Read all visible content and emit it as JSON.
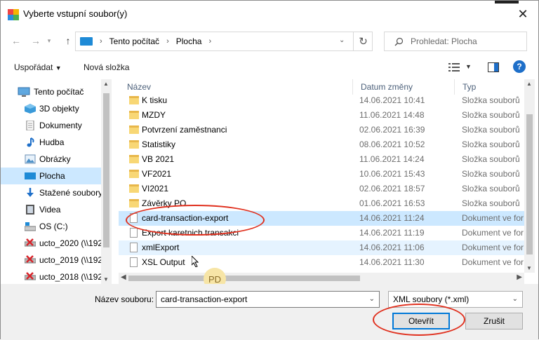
{
  "window": {
    "title": "Vyberte vstupní soubor(y)",
    "close_glyph": "✕"
  },
  "nav": {
    "back_glyph": "←",
    "forward_glyph": "→",
    "up_glyph": "↑",
    "breadcrumbs": [
      "Tento počítač",
      "Plocha"
    ],
    "refresh_glyph": "↻",
    "search_placeholder": "Prohledat: Plocha"
  },
  "toolbar": {
    "organize_label": "Uspořádat",
    "new_folder_label": "Nová složka",
    "help_glyph": "?"
  },
  "sidebar": {
    "items": [
      {
        "label": "Tento počítač",
        "icon": "pc-icon"
      },
      {
        "label": "3D objekty",
        "icon": "cube-icon"
      },
      {
        "label": "Dokumenty",
        "icon": "documents-icon"
      },
      {
        "label": "Hudba",
        "icon": "music-icon"
      },
      {
        "label": "Obrázky",
        "icon": "pictures-icon"
      },
      {
        "label": "Plocha",
        "icon": "desktop-icon",
        "selected": true
      },
      {
        "label": "Stažené soubory",
        "icon": "download-icon"
      },
      {
        "label": "Videa",
        "icon": "video-icon"
      },
      {
        "label": "OS (C:)",
        "icon": "drive-icon"
      },
      {
        "label": "ucto_2020 (\\\\192",
        "icon": "network-drive-icon"
      },
      {
        "label": "ucto_2019 (\\\\192",
        "icon": "network-drive-icon"
      },
      {
        "label": "ucto_2018 (\\\\192",
        "icon": "network-drive-icon"
      }
    ]
  },
  "columns": {
    "name": "Název",
    "date": "Datum změny",
    "type": "Typ"
  },
  "files": [
    {
      "name": "K tisku",
      "date": "14.06.2021 10:41",
      "type": "Složka souborů",
      "kind": "folder"
    },
    {
      "name": "MZDY",
      "date": "11.06.2021 14:48",
      "type": "Složka souborů",
      "kind": "folder"
    },
    {
      "name": "Potvrzení zaměstnanci",
      "date": "02.06.2021 16:39",
      "type": "Složka souborů",
      "kind": "folder"
    },
    {
      "name": "Statistiky",
      "date": "08.06.2021 10:52",
      "type": "Složka souborů",
      "kind": "folder"
    },
    {
      "name": "VB 2021",
      "date": "11.06.2021 14:24",
      "type": "Složka souborů",
      "kind": "folder"
    },
    {
      "name": "VF2021",
      "date": "10.06.2021 15:43",
      "type": "Složka souborů",
      "kind": "folder"
    },
    {
      "name": "VI2021",
      "date": "02.06.2021 18:57",
      "type": "Složka souborů",
      "kind": "folder"
    },
    {
      "name": "Závěrky PO",
      "date": "01.06.2021 16:53",
      "type": "Složka souborů",
      "kind": "folder"
    },
    {
      "name": "card-transaction-export",
      "date": "14.06.2021 11:24",
      "type": "Dokument ve for",
      "kind": "doc",
      "selected": true
    },
    {
      "name": "Export karetnich transakci",
      "date": "14.06.2021 11:19",
      "type": "Dokument ve for",
      "kind": "doc"
    },
    {
      "name": "xmlExport",
      "date": "14.06.2021 11:06",
      "type": "Dokument ve for",
      "kind": "doc",
      "hover": true
    },
    {
      "name": "XSL Output",
      "date": "14.06.2021 11:30",
      "type": "Dokument ve for",
      "kind": "doc"
    }
  ],
  "overlay": {
    "badge": "PD"
  },
  "bottom": {
    "filename_label": "Název souboru:",
    "filename_value": "card-transaction-export",
    "filetype_value": "XML soubory (*.xml)",
    "open_label": "Otevřít",
    "cancel_label": "Zrušit"
  },
  "colors": {
    "accent": "#0078d7",
    "selection": "#cce8ff",
    "annotation": "#e0301e"
  }
}
